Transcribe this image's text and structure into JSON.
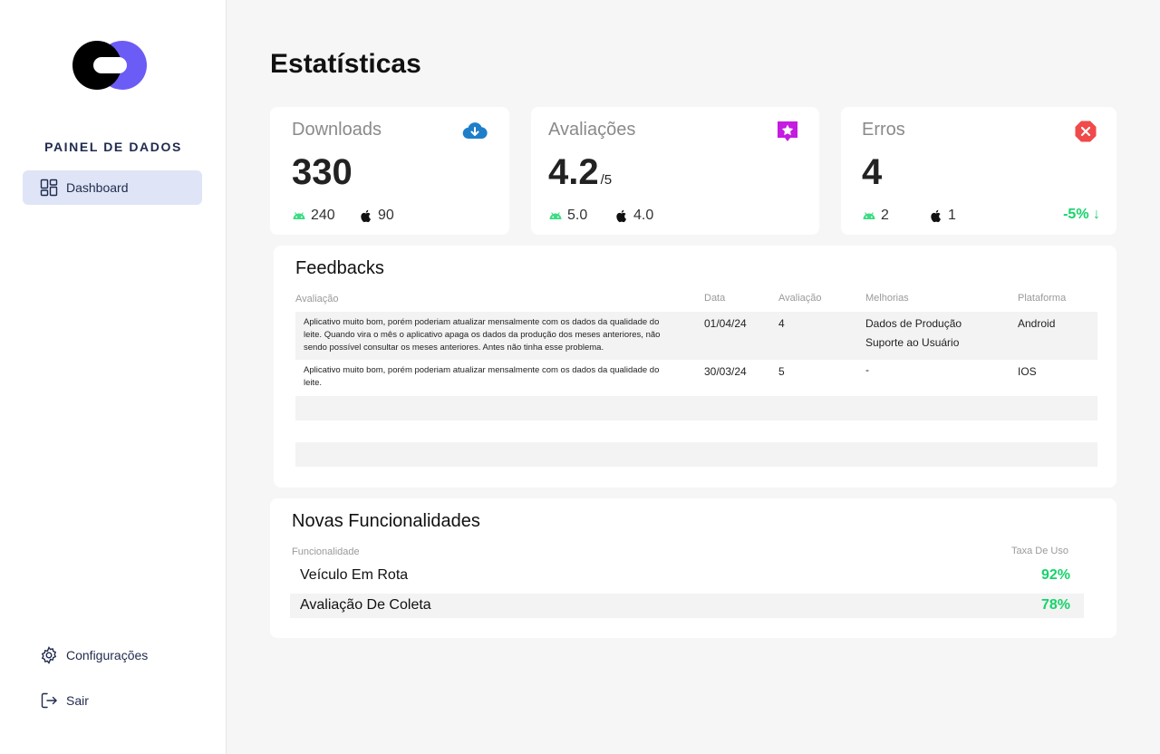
{
  "sidebar": {
    "brand": "PAINEL DE DADOS",
    "nav": [
      {
        "label": "Dashboard",
        "icon": "dashboard-icon",
        "active": true
      }
    ],
    "bottom": [
      {
        "label": "Configurações",
        "icon": "gear-icon"
      },
      {
        "label": "Sair",
        "icon": "logout-icon"
      }
    ]
  },
  "page": {
    "title": "Estatísticas"
  },
  "stats": {
    "downloads": {
      "label": "Downloads",
      "value": "330",
      "android": "240",
      "ios": "90",
      "icon": "cloud-download-icon",
      "icon_color": "#1e7ec8"
    },
    "ratings": {
      "label": "Avaliações",
      "value": "4.2",
      "suffix": "/5",
      "android": "5.0",
      "ios": "4.0",
      "icon": "star-badge-icon",
      "icon_color": "#c41ce0"
    },
    "errors": {
      "label": "Erros",
      "value": "4",
      "android": "2",
      "ios": "1",
      "trend": "-5% ↓",
      "icon": "error-x-icon",
      "icon_color": "#f04a4a"
    }
  },
  "feedbacks": {
    "title": "Feedbacks",
    "headers": [
      "Avaliação",
      "Data",
      "Avaliação",
      "Melhorias",
      "Plataforma"
    ],
    "rows": [
      {
        "text": "Aplicativo muito bom, porém poderiam atualizar mensalmente com os dados da qualidade do leite. Quando vira o mês o aplicativo apaga os dados da produção dos meses anteriores, não sendo possível consultar os meses anteriores. Antes não tinha esse problema.",
        "date": "01/04/24",
        "rating": "4",
        "improvements": [
          "Dados de Produção",
          "Suporte ao Usuário"
        ],
        "platform": "Android"
      },
      {
        "text": "Aplicativo muito bom, porém poderiam atualizar mensalmente com os dados da qualidade do leite.",
        "date": "30/03/24",
        "rating": "5",
        "improvements": [
          "-"
        ],
        "platform": "IOS"
      }
    ]
  },
  "features": {
    "title": "Novas Funcionalidades",
    "col_name": "Funcionalidade",
    "col_rate": "Taxa De Uso",
    "rows": [
      {
        "name": "Veículo Em Rota",
        "rate": "92%"
      },
      {
        "name": "Avaliação De Coleta",
        "rate": "78%"
      }
    ]
  },
  "colors": {
    "accent": "#6b5cf6",
    "positive": "#16d36b",
    "nav_active_bg": "#dfe5f6",
    "android_green": "#3ddc84"
  }
}
